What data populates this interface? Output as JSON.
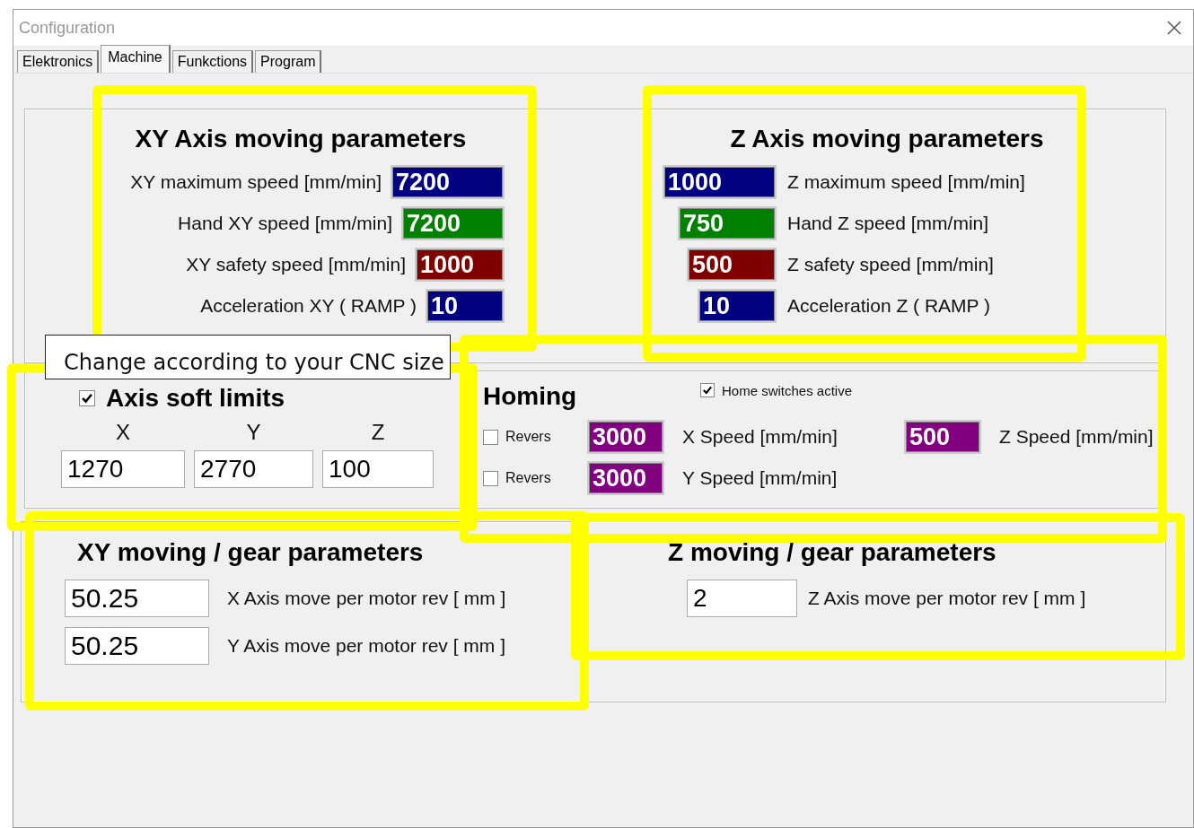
{
  "window": {
    "title": "Configuration"
  },
  "tabs": [
    {
      "label": "Elektronics",
      "selected": false
    },
    {
      "label": "Machine",
      "selected": true
    },
    {
      "label": "Funkctions",
      "selected": false
    },
    {
      "label": "Program",
      "selected": false
    }
  ],
  "xy_axis": {
    "title": "XY Axis moving parameters",
    "rows": [
      {
        "label": "XY maximum speed [mm/min]",
        "value": "7200",
        "color": "#000080"
      },
      {
        "label": "Hand XY speed [mm/min]",
        "value": "7200",
        "color": "#008000"
      },
      {
        "label": "XY safety speed [mm/min]",
        "value": "1000",
        "color": "#800000"
      },
      {
        "label": "Acceleration XY ( RAMP )",
        "value": "10",
        "color": "#000080"
      }
    ]
  },
  "z_axis": {
    "title": "Z Axis moving parameters",
    "rows": [
      {
        "label": "Z maximum speed [mm/min]",
        "value": "1000",
        "color": "#000080"
      },
      {
        "label": "Hand Z speed [mm/min]",
        "value": "750",
        "color": "#008000"
      },
      {
        "label": "Z safety speed [mm/min]",
        "value": "500",
        "color": "#800000"
      },
      {
        "label": "Acceleration Z ( RAMP )",
        "value": "10",
        "color": "#000080"
      }
    ]
  },
  "callout": "Change according to your CNC size",
  "soft_limits": {
    "label": "Axis soft limits",
    "checked": true,
    "axes": [
      {
        "axis": "X",
        "value": "1270"
      },
      {
        "axis": "Y",
        "value": "2770"
      },
      {
        "axis": "Z",
        "value": "100"
      }
    ]
  },
  "homing": {
    "title": "Homing",
    "home_switches": {
      "label": "Home switches active",
      "checked": true
    },
    "rows": [
      {
        "revers": {
          "label": "Revers",
          "checked": false
        },
        "value": "3000",
        "color": "#800080",
        "label": "X Speed [mm/min]"
      },
      {
        "revers": {
          "label": "Revers",
          "checked": false
        },
        "value": "3000",
        "color": "#800080",
        "label": "Y Speed [mm/min]"
      }
    ],
    "z": {
      "value": "500",
      "color": "#800080",
      "label": "Z Speed [mm/min]"
    }
  },
  "xy_gear": {
    "title": "XY moving / gear parameters",
    "rows": [
      {
        "value": "50.25",
        "label": "X Axis move per motor rev [ mm ]"
      },
      {
        "value": "50.25",
        "label": "Y Axis move per motor rev [ mm ]"
      }
    ]
  },
  "z_gear": {
    "title": "Z moving / gear parameters",
    "rows": [
      {
        "value": "2",
        "label": "Z Axis move per motor rev [ mm ]"
      }
    ]
  }
}
